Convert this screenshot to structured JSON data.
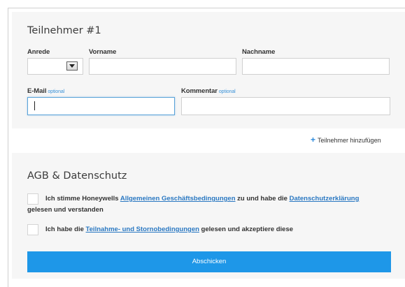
{
  "participant": {
    "title": "Teilnehmer #1",
    "anrede_label": "Anrede",
    "anrede_value": "",
    "vorname_label": "Vorname",
    "vorname_value": "",
    "nachname_label": "Nachname",
    "nachname_value": "",
    "email_label": "E-Mail",
    "email_optional": "optional",
    "email_value": "",
    "kommentar_label": "Kommentar",
    "kommentar_optional": "optional",
    "kommentar_value": ""
  },
  "add_participant": {
    "icon": "plus-icon",
    "label": "Teilnehmer hinzufügen"
  },
  "terms": {
    "title": "AGB & Datenschutz",
    "check1_text_a": "Ich stimme Honeywells ",
    "check1_link1": "Allgemeinen Geschäftsbedingungen",
    "check1_text_b": " zu und habe die ",
    "check1_link2": "Datenschutzerklärung",
    "check1_text_c": "gelesen und verstanden",
    "check2_text_a": "Ich habe die ",
    "check2_link": "Teilnahme- und Stornobedingungen",
    "check2_text_b": " gelesen und akzeptiere diese"
  },
  "submit_label": "Abschicken",
  "colors": {
    "accent": "#1e97e8",
    "link": "#2a78c2",
    "panel_bg": "#f6f6f6"
  }
}
